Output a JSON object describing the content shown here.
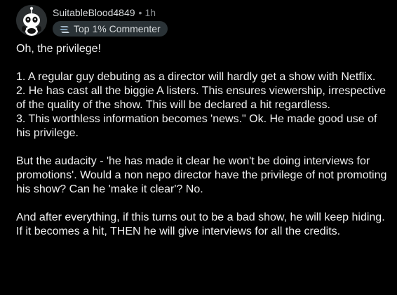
{
  "comment": {
    "author": "SuitableBlood4849",
    "separator": "•",
    "time": "1h",
    "flair": "Top 1% Commenter",
    "paragraphs": [
      [
        "Oh, the privilege!"
      ],
      [
        "1. A regular guy debuting as a director will hardly get a show with Netflix.",
        "2. He has cast all the biggie A listers. This ensures viewership, irrespective of the quality of the show. This will be declared a hit regardless.",
        "3. This worthless information becomes 'news.\" Ok. He made good use of his privilege."
      ],
      [
        "But the audacity - 'he has made it clear he won't be doing interviews for promotions'. Would a non nepo director have the privilege of not promoting his show? Can he 'make it clear'? No."
      ],
      [
        "And after everything, if this turns out to be a bad show, he will keep hiding. If it becomes a hit, THEN he will give interviews for all the credits."
      ]
    ]
  },
  "colors": {
    "background": "#000000",
    "text": "#f0f0f0",
    "muted": "#8b8f93",
    "flair_bg": "#2a3236"
  },
  "icons": {
    "avatar": "snoo-avatar-icon",
    "flair": "top-commenter-badge-icon"
  }
}
